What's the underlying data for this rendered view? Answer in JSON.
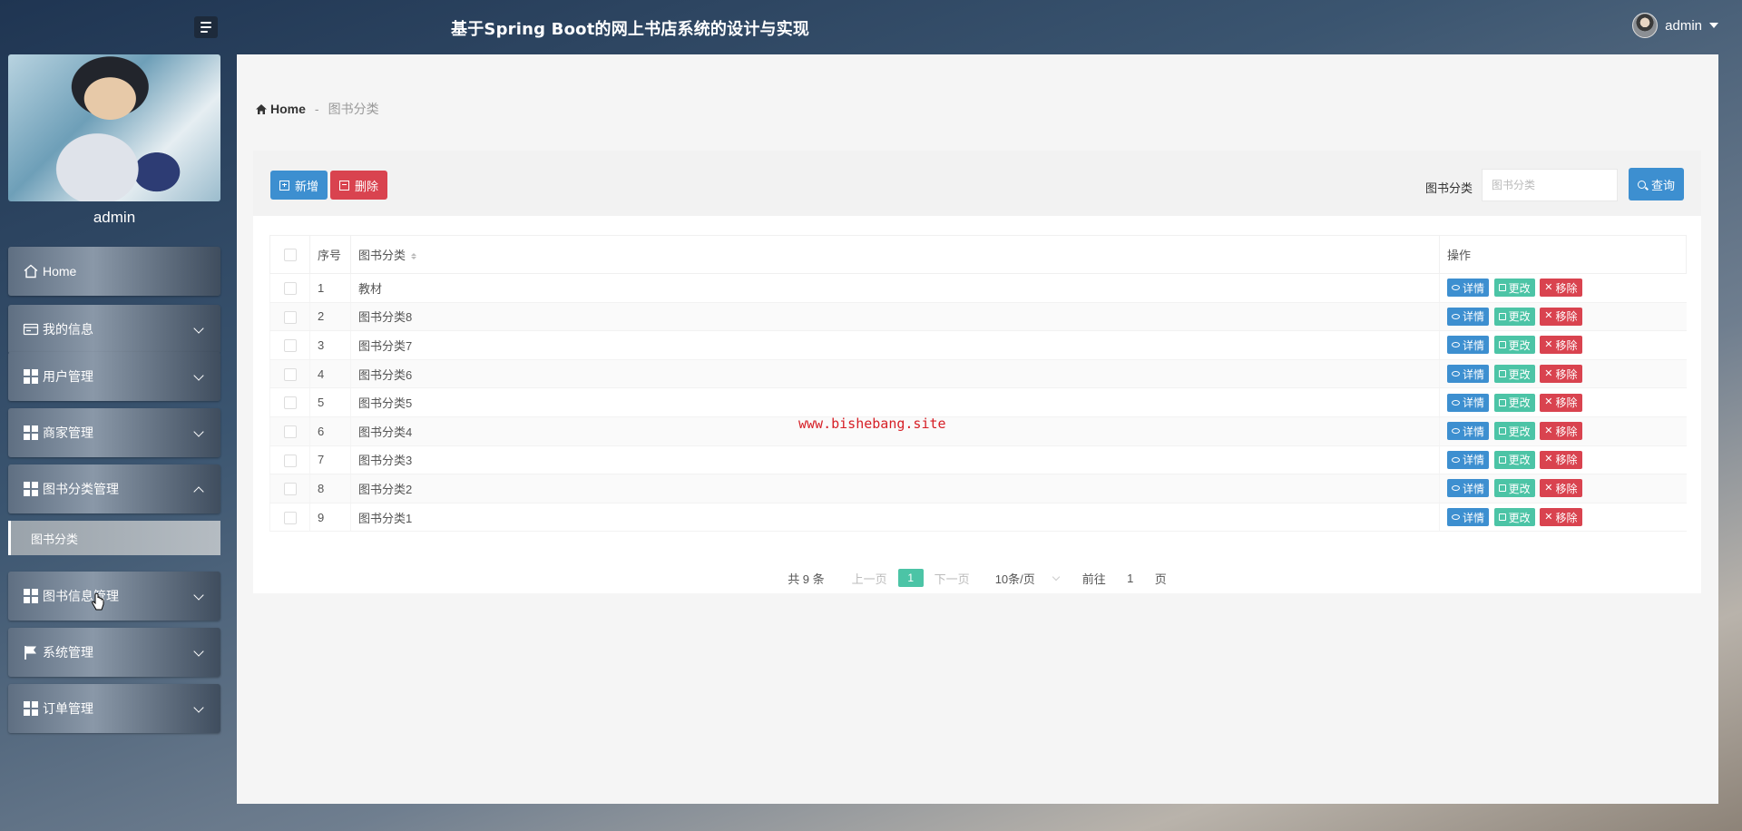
{
  "header": {
    "title": "基于Spring Boot的网上书店系统的设计与实现",
    "user_name": "admin"
  },
  "sidebar": {
    "profile_name": "admin",
    "items": [
      {
        "label": "Home",
        "icon": "home-icon"
      },
      {
        "label": "我的信息",
        "icon": "id-card-icon"
      },
      {
        "label": "用户管理",
        "icon": "grid-icon"
      },
      {
        "label": "商家管理",
        "icon": "grid-icon"
      },
      {
        "label": "图书分类管理",
        "icon": "grid-icon",
        "expanded": true
      },
      {
        "label": "图书信息管理",
        "icon": "grid-icon"
      },
      {
        "label": "系统管理",
        "icon": "flag-icon"
      },
      {
        "label": "订单管理",
        "icon": "grid-icon"
      }
    ],
    "sub_item": "图书分类"
  },
  "breadcrumb": {
    "home": "Home",
    "separator": "-",
    "current": "图书分类"
  },
  "toolbar": {
    "add_label": "新增",
    "delete_label": "删除",
    "search_label": "图书分类",
    "search_placeholder": "图书分类",
    "search_button": "查询"
  },
  "table": {
    "headers": {
      "index": "序号",
      "category": "图书分类",
      "ops": "操作"
    },
    "rows": [
      {
        "index": "1",
        "category": "教材"
      },
      {
        "index": "2",
        "category": "图书分类8"
      },
      {
        "index": "3",
        "category": "图书分类7"
      },
      {
        "index": "4",
        "category": "图书分类6"
      },
      {
        "index": "5",
        "category": "图书分类5"
      },
      {
        "index": "6",
        "category": "图书分类4"
      },
      {
        "index": "7",
        "category": "图书分类3"
      },
      {
        "index": "8",
        "category": "图书分类2"
      },
      {
        "index": "9",
        "category": "图书分类1"
      }
    ],
    "op_labels": {
      "detail": "详情",
      "edit": "更改",
      "remove": "移除"
    }
  },
  "pagination": {
    "total": "共 9 条",
    "prev": "上一页",
    "current": "1",
    "next": "下一页",
    "page_size": "10条/页",
    "goto_label": "前往",
    "goto_value": "1",
    "page_unit": "页"
  },
  "watermark": "www.bishebang.site",
  "colors": {
    "primary": "#3d8fd0",
    "danger": "#d9434f",
    "success": "#4cc4a6"
  }
}
